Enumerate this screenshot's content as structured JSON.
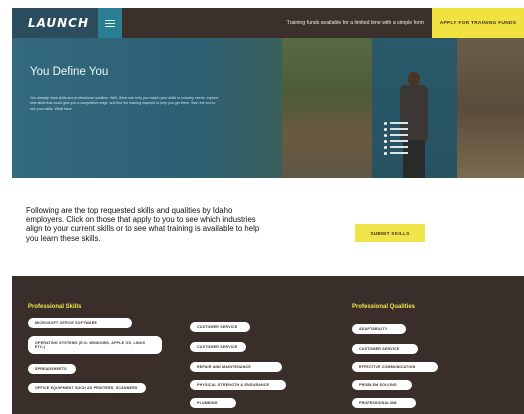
{
  "header": {
    "logo_text": "LAUNCH",
    "promo_text": "Training funds available for a limited time with a simple form",
    "apply_label": "APPLY FOR TRAINING FUNDS"
  },
  "hero": {
    "title": "You Define You",
    "body": "You already have skills and professional qualities. Well, What can help you match your skills to industry needs, explore new skills that could give you a competitive edge, and find the training required to help you get there. Start the tool to see your skills. What have."
  },
  "intro": {
    "text": "Following are the top requested skills and qualities by Idaho employers. Click on those that apply to you to see which industries align to your current skills or to see what training is available to help you learn these skills."
  },
  "submit_label": "SUBMIT SKILLS",
  "professional_skills": {
    "title": "Professional Skills",
    "column_a": [
      "MICROSOFT OFFICE SOFTWARE",
      "OPERATING SYSTEMS (E.G. WINDOWS, APPLE OS, LINUX ETC.)",
      "SPREADSHEETS",
      "OFFICE EQUIPMENT SUCH AS PRINTERS, SCANNERS"
    ],
    "column_b": [
      "CUSTOMER SERVICE",
      "CUSTOMER SERVICE",
      "REPAIR AND MAINTENANCE",
      "PHYSICAL STRENGTH & ENDURANCE",
      "PLUMBING"
    ]
  },
  "professional_qualities": {
    "title": "Professional Qualities",
    "items": [
      "ADAPTABILITY",
      "CUSTOMER SERVICE",
      "EFFECTIVE COMMUNICATION",
      "PROBLEM SOLVING",
      "PROFESSIONALISM"
    ]
  }
}
